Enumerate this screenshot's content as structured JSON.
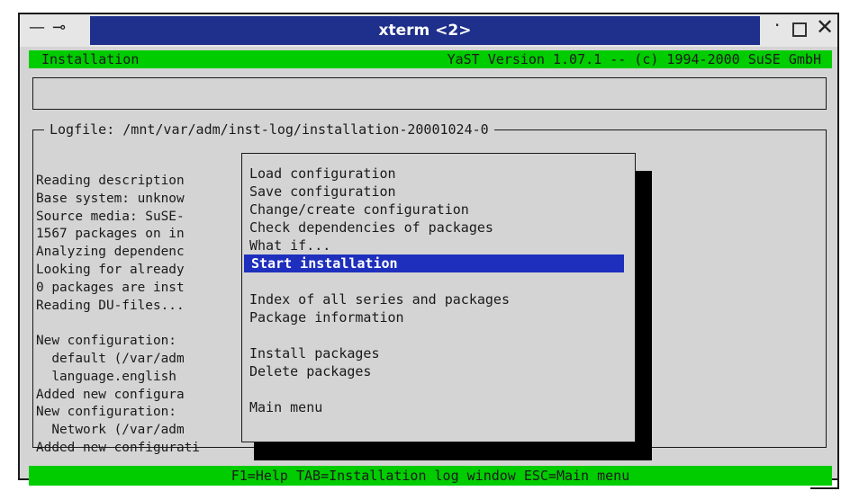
{
  "window": {
    "title": "xterm <2>",
    "controls": {
      "menu_icon": "dash-icon",
      "pin_icon": "pin-icon",
      "minimize_icon": "dot-icon",
      "maximize_icon": "square-icon",
      "close_icon": "x-icon"
    }
  },
  "status": {
    "left": "Installation",
    "right": "YaST Version 1.07.1 -- (c) 1994-2000 SuSE GmbH"
  },
  "input_box": {
    "value": ""
  },
  "log": {
    "title": "Logfile: /mnt/var/adm/inst-log/installation-20001024-0",
    "lines": [
      "Reading description",
      "Base system: unknow",
      "Source media: SuSE-",
      "1567 packages on in",
      "Analyzing dependenc",
      "Looking for already",
      "0 packages are inst",
      "Reading DU-files...",
      "",
      "New configuration:",
      "  default (/var/adm",
      "  language.english",
      "Added new configura",
      "New configuration:",
      "  Network (/var/adm",
      "Added new configurati"
    ]
  },
  "menu": {
    "items": [
      "Load configuration",
      "Save configuration",
      "Change/create configuration",
      "Check dependencies of packages",
      "What if...",
      "Start installation",
      "",
      "Index of all series and packages",
      "Package information",
      "",
      "Install packages",
      "Delete packages",
      "",
      "Main menu"
    ],
    "selected_index": 5
  },
  "bottom_bar": {
    "text": "F1=Help  TAB=Installation log window  ESC=Main menu"
  },
  "colors": {
    "title_bg": "#1e2f8c",
    "status_green": "#00cc00",
    "selection_blue": "#1e2fbd",
    "terminal_bg": "#d4d4d4"
  }
}
